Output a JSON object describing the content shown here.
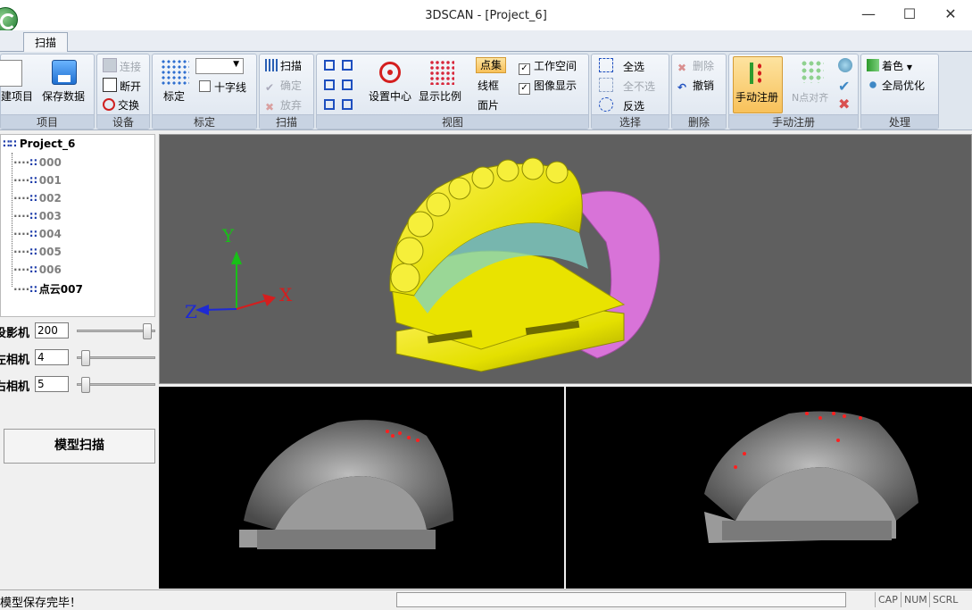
{
  "window": {
    "title": "3DSCAN - [Project_6]",
    "minimize_icon": "—",
    "maximize_icon": "☐",
    "close_icon": "✕"
  },
  "tabs": [
    {
      "label": "扫描",
      "active": true
    }
  ],
  "ribbon": {
    "project": {
      "label": "项目",
      "new_label": "建项目",
      "save_label": "保存数据"
    },
    "device": {
      "label": "设备",
      "connect": "连接",
      "disconnect": "断开",
      "swap": "交换"
    },
    "calib": {
      "label": "标定",
      "calibrate": "标定",
      "crosshair": "十字线",
      "dropdown_value": ""
    },
    "scan": {
      "label": "扫描",
      "scan": "扫描",
      "confirm": "确定",
      "discard": "放弃"
    },
    "view": {
      "label": "视图",
      "set_center": "设置中心",
      "show_scale": "显示比例",
      "point_set": "点集",
      "wireframe": "线框",
      "patch": "面片",
      "workspace": "工作空间",
      "image_display": "图像显示"
    },
    "select": {
      "label": "选择",
      "select_all": "全选",
      "select_none": "全不选",
      "invert": "反选"
    },
    "delete": {
      "label": "删除",
      "delete": "删除",
      "undo": "撤销"
    },
    "manual_reg": {
      "label": "手动注册",
      "manual_reg": "手动注册",
      "n_point_align": "N点对齐"
    },
    "process": {
      "label": "处理",
      "color": "着色",
      "global_opt": "全局优化"
    }
  },
  "tree": {
    "root": "Project_6",
    "items": [
      "000",
      "001",
      "002",
      "003",
      "004",
      "005",
      "006",
      "点云007"
    ]
  },
  "controls": {
    "projector": {
      "label": "投影机",
      "value": "200",
      "level": 0.95
    },
    "left_cam": {
      "label": "左相机",
      "value": "4",
      "level": 0.07
    },
    "right_cam": {
      "label": "右相机",
      "value": "5",
      "level": 0.07
    },
    "model_scan_button": "模型扫描"
  },
  "axes": {
    "x": "X",
    "y": "Y",
    "z": "Z"
  },
  "status": {
    "message": "模型保存完毕！",
    "cap": "CAP",
    "num": "NUM",
    "scrl": "SCRL"
  },
  "colors": {
    "model_yellow": "#e4e000",
    "model_magenta": "#d873d8",
    "model_cyan": "#7fd3c8",
    "viewport_bg": "#5f5f5f"
  }
}
